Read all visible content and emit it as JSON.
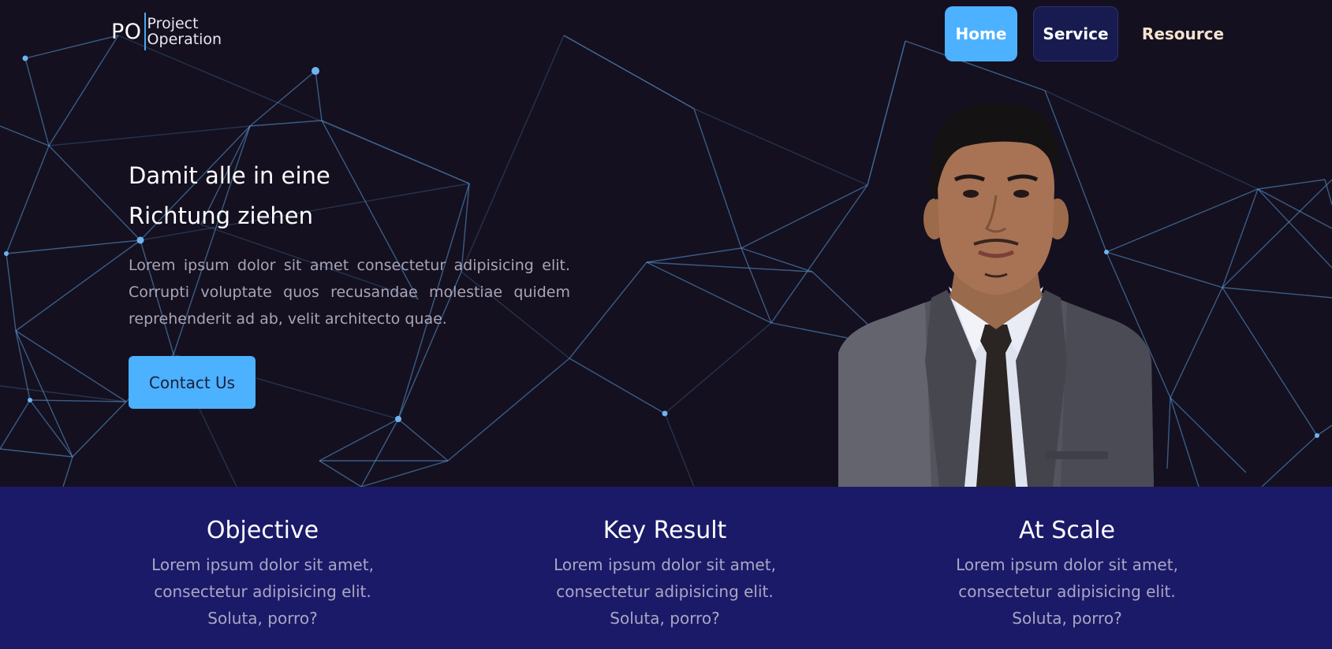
{
  "logo": {
    "mark": "PO",
    "line1": "Project",
    "line2": "Operation"
  },
  "nav": {
    "items": [
      {
        "label": "Home"
      },
      {
        "label": "Service"
      },
      {
        "label": "Resource"
      }
    ]
  },
  "hero": {
    "title_line1": "Damit alle in eine",
    "title_line2": "Richtung ziehen",
    "description": "Lorem ipsum dolor sit amet consectetur adipisicing elit. Corrupti voluptate quos recusandae molestiae quidem reprehenderit ad ab, velit architecto quae.",
    "cta_label": "Contact Us"
  },
  "features": [
    {
      "title": "Objective",
      "line1": "Lorem ipsum dolor sit amet,",
      "line2": "consectetur adipisicing elit.",
      "line3": "Soluta, porro?"
    },
    {
      "title": "Key Result",
      "line1": "Lorem ipsum dolor sit amet,",
      "line2": "consectetur adipisicing elit.",
      "line3": "Soluta, porro?"
    },
    {
      "title": "At Scale",
      "line1": "Lorem ipsum dolor sit amet,",
      "line2": "consectetur adipisicing elit.",
      "line3": "Soluta, porro?"
    }
  ],
  "colors": {
    "hero_bg": "#141020",
    "accent": "#4cb1ff",
    "features_bg": "#1b1a68",
    "service_bg": "#181b4f",
    "resource_text": "#f5e3cf"
  }
}
